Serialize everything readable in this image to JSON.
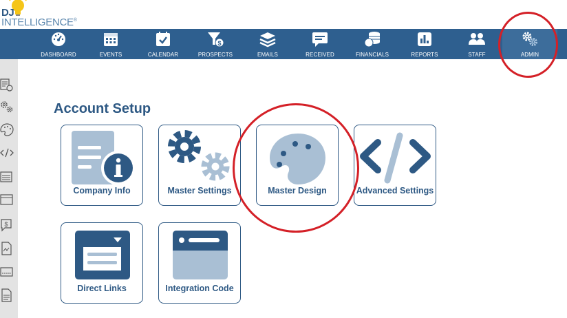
{
  "brand": {
    "dj": "DJ",
    "intel": "INTELLIGENCE",
    "reg": "®"
  },
  "nav": {
    "items": [
      {
        "label": "DASHBOARD",
        "icon": "dashboard-gauge-icon"
      },
      {
        "label": "EVENTS",
        "icon": "events-grid-icon"
      },
      {
        "label": "CALENDAR",
        "icon": "calendar-check-icon"
      },
      {
        "label": "PROSPECTS",
        "icon": "funnel-dollar-icon"
      },
      {
        "label": "EMAILS",
        "icon": "layers-icon"
      },
      {
        "label": "RECEIVED",
        "icon": "chat-bubble-icon"
      },
      {
        "label": "FINANCIALS",
        "icon": "coins-icon"
      },
      {
        "label": "REPORTS",
        "icon": "bar-chart-icon"
      },
      {
        "label": "STAFF",
        "icon": "people-icon"
      },
      {
        "label": "ADMIN",
        "icon": "gears-icon"
      }
    ]
  },
  "page": {
    "title": "Account Setup"
  },
  "tiles": {
    "company_info": "Company Info",
    "master_settings": "Master Settings",
    "master_design": "Master Design",
    "advanced_settings": "Advanced Settings",
    "direct_links": "Direct Links",
    "integration_code": "Integration Code"
  },
  "colors": {
    "nav_bg": "#2e5f8f",
    "accent": "#2e5984",
    "icon_light": "#a9bfd4",
    "highlight": "#d42027"
  }
}
